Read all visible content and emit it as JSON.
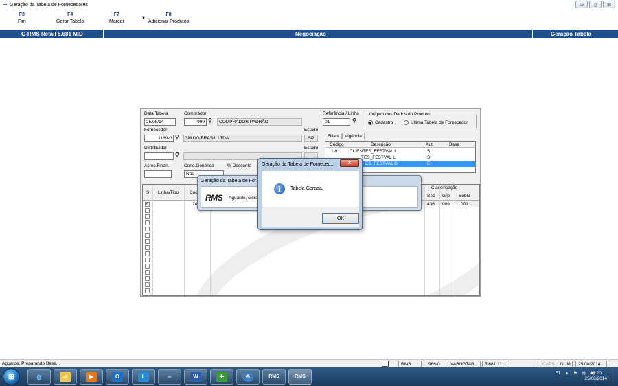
{
  "window": {
    "title": "Geração da Tabela de Fornecedores",
    "buttons": [
      "▭",
      "▯",
      "⊠"
    ]
  },
  "toolbar": {
    "items": [
      {
        "key": "F3",
        "label": "Fim"
      },
      {
        "key": "F4",
        "label": "Gerar Tabela"
      },
      {
        "key": "F7",
        "label": "Marcar"
      },
      {
        "key": "F8",
        "label": "Adicionar Produtos"
      }
    ]
  },
  "header": {
    "version": "G-RMS Retail 5.681 MID",
    "module": "Negociação",
    "screen": "Geração Tabela"
  },
  "form": {
    "data_tabela_label": "Data Tabela",
    "data_tabela": "25/08/14",
    "comprador_label": "Comprador",
    "comprador_code": "999",
    "comprador_name": "COMPRADOR PADRÃO",
    "referencia_label": "Referência / Linha",
    "referencia": "01",
    "fornecedor_label": "Fornecedor",
    "fornecedor_code": "1169-0",
    "fornecedor_name": "3M DO BRASIL LTDA",
    "estado_label": "Estado",
    "estado": "SP",
    "distribuidor_label": "Distribuidor",
    "distribuidor_code": "",
    "distribuidor_name": "",
    "estado2_label": "Estado",
    "acres_label": "Acres.Finan.",
    "acres": "",
    "cond_label": "Cond.Genérica",
    "cond": "Não",
    "desconto_label": "% Desconto",
    "origem": {
      "title": "Origem dos Dados do Produto",
      "options": [
        "Cadastro",
        "Ultima Tabela de Fornecedor"
      ],
      "selected": "Cadastro"
    },
    "tabs": [
      "Filiais",
      "Vigência"
    ],
    "filiais": {
      "headers": [
        "Código",
        "Descrição",
        "Aut",
        "Base"
      ],
      "rows": [
        {
          "codigo": "1-9",
          "descricao": "CLIENTES_FESTVAL L",
          "aut": "S",
          "base": ""
        },
        {
          "codigo": "",
          "descricao": "TES_FESTVAL L",
          "aut": "S",
          "base": ""
        },
        {
          "codigo": "",
          "descricao": "ES_FESTVAL D",
          "aut": "E",
          "base": ""
        }
      ]
    },
    "grid": {
      "col_s": "S",
      "col_linha": "Linha/Tipo",
      "col_cod": "Cód",
      "classificacao": "Classificação",
      "class_cols": [
        "Sec",
        "Grp",
        "SubG"
      ],
      "first_row": {
        "cod": "288",
        "sec": "436",
        "grp": "009",
        "subg": "001"
      },
      "checked": [
        true,
        false,
        false,
        false,
        false,
        false,
        false,
        false,
        false,
        false,
        false,
        false,
        false,
        false
      ]
    }
  },
  "dialog_progress": {
    "title": "Geração da Tabela de For",
    "logo": "RMS",
    "message": "Aguarde, Gera"
  },
  "dialog_message": {
    "title": "Geração da Tabela de Forneced...",
    "close": "x",
    "text": "Tabela Gerada.",
    "ok": "OK"
  },
  "statusbar": {
    "message": "Aguarde, Preparando Base...",
    "cells": [
      "RMS",
      "966-0",
      "VABUGTAB",
      "5.681.11",
      "",
      "CAPS",
      "NUM",
      "25/08/2014"
    ]
  },
  "taskbar": {
    "apps": [
      "e",
      "📁",
      "▶",
      "O",
      "L",
      "∞",
      "W",
      "✚",
      "⚙",
      "RMS",
      "RMS"
    ],
    "tray": [
      "FT",
      "▲",
      "⚑",
      "▤",
      "◀)"
    ],
    "time": "16:20",
    "date": "25/08/2014"
  }
}
